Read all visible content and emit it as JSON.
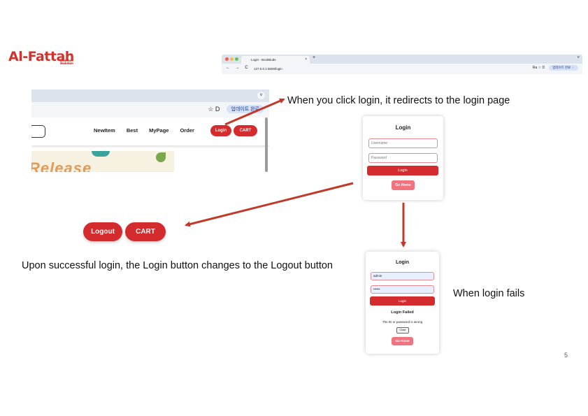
{
  "logo": {
    "text": "Al-Fattah",
    "subtitle": "Bookstore\nBookstore"
  },
  "browser": {
    "tab_title": "Login - BookBuds",
    "tab_close": "×",
    "new_tab": "+",
    "nav": "← → C",
    "url": "127.0.0.1:5000/login",
    "right_icons": "Ra ☆ D",
    "profile": "업데이트 완료 ⋮",
    "chevron": "˅"
  },
  "site": {
    "chevron": "˅",
    "icons": "☆  D",
    "profile": "업데이트 완료",
    "nav": [
      "NewItem",
      "Best",
      "MyPage",
      "Order"
    ],
    "login_label": "Login",
    "cart_label": "CART",
    "banner_text": "Release"
  },
  "notes": {
    "redirect": "When you click login, it redirects to the login page",
    "success": "Upon successful login, the Login button changes to the Logout button",
    "fail": "When login fails"
  },
  "login_card": {
    "title": "Login",
    "username_placeholder": "Username",
    "password_placeholder": "Password",
    "submit": "Login",
    "go_home": "Go Home"
  },
  "fail_card": {
    "title": "Login",
    "username_value": "admin",
    "password_value": "••••••",
    "submit": "Login",
    "failed_title": "Login Failed",
    "failed_msg": "The ID or password is wrong",
    "close": "Close",
    "go_home": "Go Home"
  },
  "after_login": {
    "logout": "Logout",
    "cart": "CART"
  },
  "page_number": "5",
  "colors": {
    "brand_red": "#d42b2f",
    "arrow": "#c0392b",
    "go_home": "#f0737f"
  }
}
